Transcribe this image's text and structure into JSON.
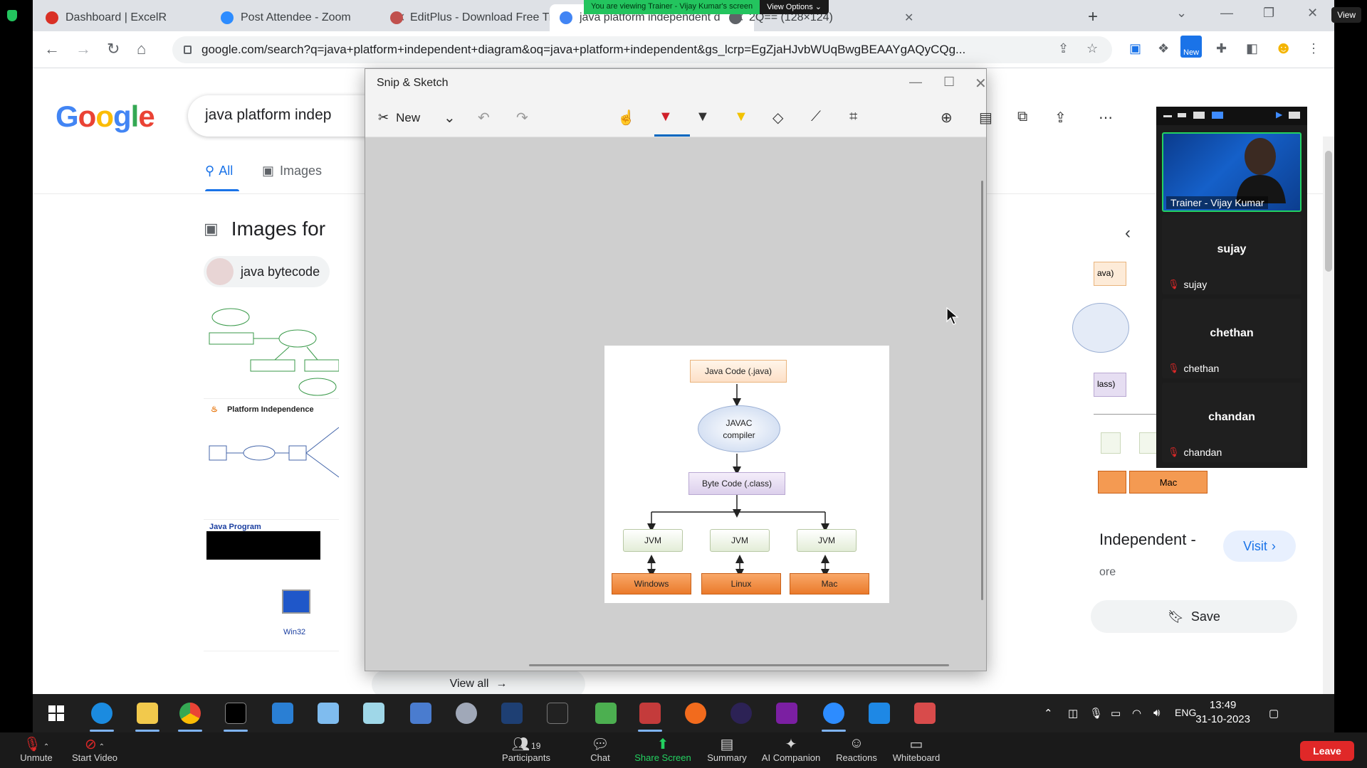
{
  "zoom": {
    "share_banner": "You are viewing Trainer - Vijay Kumar's screen",
    "view_options": "View Options ⌄",
    "view_button": "View",
    "controls": {
      "unmute": "Unmute",
      "start_video": "Start Video",
      "participants": "Participants",
      "participants_count": "19",
      "chat": "Chat",
      "share_screen": "Share Screen",
      "summary": "Summary",
      "ai_companion": "AI Companion",
      "reactions": "Reactions",
      "whiteboard": "Whiteboard",
      "leave": "Leave"
    },
    "gallery": {
      "trainer_label": "Trainer - Vijay Kumar",
      "participants": [
        {
          "name": "sujay"
        },
        {
          "name": "chethan"
        },
        {
          "name": "chandan"
        }
      ]
    }
  },
  "browser": {
    "tabs": [
      {
        "title": "Dashboard | ExcelR",
        "color": "#d93025"
      },
      {
        "title": "Post Attendee - Zoom",
        "color": "#2d8cff"
      },
      {
        "title": "EditPlus - Download Free Tr",
        "color": "#c0504d"
      },
      {
        "title": "java platform independent d",
        "color": "#4285f4"
      },
      {
        "title": "2Q== (128×124)",
        "color": "#5f6368"
      }
    ],
    "url": "google.com/search?q=java+platform+independent+diagram&oq=java+platform+independent&gs_lcrp=EgZjaHJvbWUqBwgBEAAYgAQyCQg...",
    "extension_new_label": "New"
  },
  "google": {
    "logo": "Google",
    "query": "java platform indep",
    "tabs": {
      "all": "All",
      "images": "Images"
    },
    "images_heading": "Images for",
    "chip_label": "java bytecode",
    "thumb_caption_platform": "Platform Independence",
    "thumb_caption_program": "Java Program",
    "thumb_caption_win32": "Win32",
    "view_all": "View all",
    "right_panel": {
      "title": "Independent -",
      "more": "ore",
      "visit": "Visit",
      "save": "Save",
      "partial_labels": [
        "ava)",
        "lass)",
        "Mac"
      ]
    }
  },
  "snip": {
    "title": "Snip & Sketch",
    "new_label": "New",
    "diagram": {
      "java_code": "Java Code (.java)",
      "compiler_line1": "JAVAC",
      "compiler_line2": "compiler",
      "byte_code": "Byte Code (.class)",
      "jvm": [
        "JVM",
        "JVM",
        "JVM"
      ],
      "os": [
        "Windows",
        "Linux",
        "Mac"
      ]
    }
  },
  "taskbar": {
    "language": "ENG",
    "time": "13:49",
    "date": "31-10-2023"
  }
}
